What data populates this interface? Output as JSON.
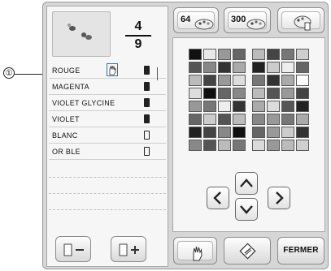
{
  "callout": {
    "number": "①"
  },
  "pattern_counter": {
    "current": "4",
    "total": "9"
  },
  "thread_list": [
    {
      "name": "ROUGE",
      "spool": "filled"
    },
    {
      "name": "MAGENTA",
      "spool": "filled"
    },
    {
      "name": "VIOLET GLYCINE",
      "spool": "filled"
    },
    {
      "name": "VIOLET",
      "spool": "filled"
    },
    {
      "name": "BLANC",
      "spool": "outline"
    },
    {
      "name": "OR BLE",
      "spool": "outline"
    }
  ],
  "palette_buttons": {
    "btn64": "64",
    "btn300": "300"
  },
  "footer": {
    "fermer_label": "FERMER"
  },
  "colors": {
    "accent_blue": "#2f64b0"
  }
}
